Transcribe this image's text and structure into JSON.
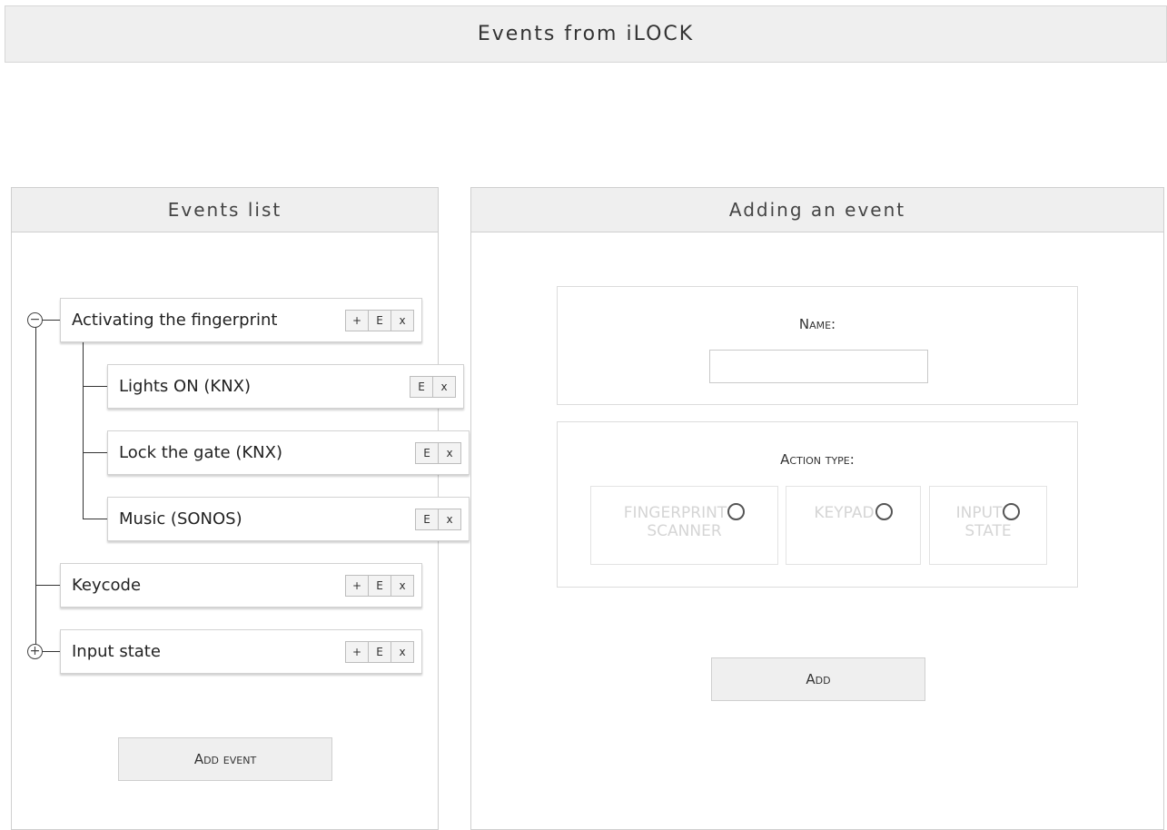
{
  "header": {
    "title": "Events from iLOCK"
  },
  "events_panel": {
    "title": "Events list",
    "add_event_label": "Add event",
    "events": [
      {
        "label": "Activating the fingerprint",
        "toggle": "−",
        "buttons": [
          "+",
          "E",
          "x"
        ],
        "children": [
          {
            "label": "Lights ON (KNX)",
            "buttons": [
              "E",
              "x"
            ]
          },
          {
            "label": "Lock the gate (KNX)",
            "buttons": [
              "E",
              "x"
            ]
          },
          {
            "label": "Music (SONOS)",
            "buttons": [
              "E",
              "x"
            ]
          }
        ]
      },
      {
        "label": "Keycode",
        "buttons": [
          "+",
          "E",
          "x"
        ]
      },
      {
        "label": "Input state",
        "toggle": "+",
        "buttons": [
          "+",
          "E",
          "x"
        ]
      }
    ]
  },
  "form_panel": {
    "title": "Adding an event",
    "name_label": "Name:",
    "name_value": "",
    "action_type_label": "Action type:",
    "options": [
      {
        "line1": "FINGERPRINT",
        "line2": "SCANNER"
      },
      {
        "line1": "KEYPAD",
        "line2": ""
      },
      {
        "line1": "INPUT",
        "line2": "STATE"
      }
    ],
    "add_label": "Add"
  }
}
